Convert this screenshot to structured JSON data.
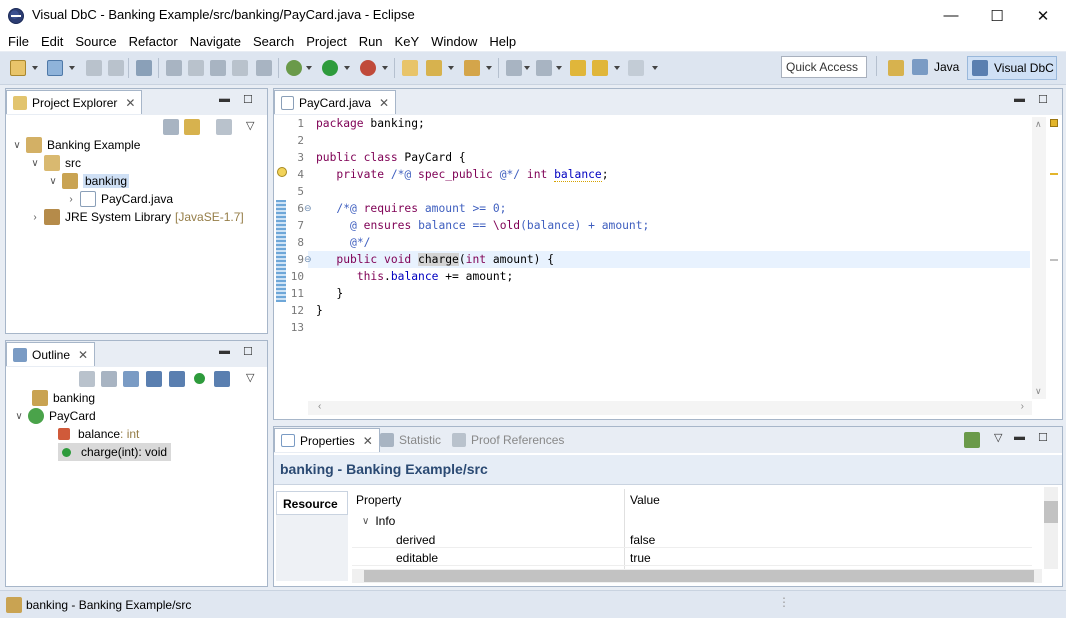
{
  "window": {
    "title": "Visual DbC - Banking Example/src/banking/PayCard.java - Eclipse",
    "minimize": "—",
    "maximize": "☐",
    "close": "✕"
  },
  "menu": [
    "File",
    "Edit",
    "Source",
    "Refactor",
    "Navigate",
    "Search",
    "Project",
    "Run",
    "KeY",
    "Window",
    "Help"
  ],
  "toolbar": {
    "quick_access": "Quick Access",
    "perspectives": [
      "Java",
      "Visual DbC"
    ]
  },
  "project_explorer": {
    "tab": "Project Explorer",
    "tree": [
      {
        "label": "Banking Example",
        "suffix": ""
      },
      {
        "label": "src",
        "suffix": ""
      },
      {
        "label": "banking",
        "suffix": ""
      },
      {
        "label": "PayCard.java",
        "suffix": ""
      },
      {
        "label": "JRE System Library",
        "suffix": "[JavaSE-1.7]"
      }
    ]
  },
  "outline": {
    "tab": "Outline",
    "tree": [
      {
        "label": "banking",
        "type": ""
      },
      {
        "label": "PayCard",
        "type": ""
      },
      {
        "label": "balance",
        "type": " : int"
      },
      {
        "label": "charge(int)",
        "type": " : void"
      }
    ]
  },
  "editor": {
    "tab": "PayCard.java",
    "line_numbers": [
      "1",
      "2",
      "3",
      "4",
      "5",
      "6",
      "7",
      "8",
      "9",
      "10",
      "11",
      "12",
      "13"
    ]
  },
  "properties": {
    "tabs": [
      "Properties",
      "Statistic",
      "Proof References"
    ],
    "title": "banking - Banking Example/src",
    "side_tab": "Resource",
    "columns": [
      "Property",
      "Value"
    ],
    "group": "Info",
    "rows": [
      {
        "property": "derived",
        "value": "false"
      },
      {
        "property": "editable",
        "value": "true"
      }
    ]
  },
  "status": {
    "text": "banking - Banking Example/src"
  },
  "colors": {
    "keyword": "#7f0055",
    "jml": "#3f5fbf",
    "field": "#0000c0",
    "selection": "#cfe0f5"
  }
}
